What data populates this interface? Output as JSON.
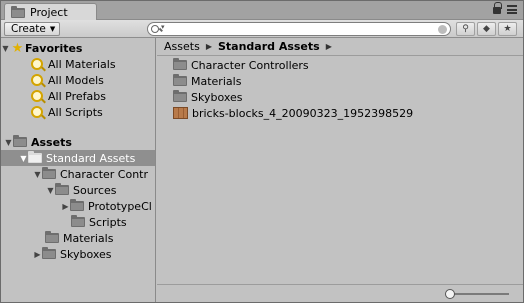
{
  "tab": {
    "title": "Project"
  },
  "toolbar": {
    "create_label": "Create",
    "search_placeholder": ""
  },
  "favorites": {
    "label": "Favorites",
    "items": [
      {
        "label": "All Materials"
      },
      {
        "label": "All Models"
      },
      {
        "label": "All Prefabs"
      },
      {
        "label": "All Scripts"
      }
    ]
  },
  "tree": {
    "assets": "Assets",
    "standard_assets": "Standard Assets",
    "character_controllers": "Character Contr",
    "sources": "Sources",
    "prototype": "PrototypeCl",
    "scripts": "Scripts",
    "materials": "Materials",
    "skyboxes": "Skyboxes"
  },
  "breadcrumb": {
    "root": "Assets",
    "current": "Standard Assets"
  },
  "files": [
    {
      "label": "Character Controllers",
      "icon": "folder-icon"
    },
    {
      "label": "Materials",
      "icon": "folder-icon"
    },
    {
      "label": "Skyboxes",
      "icon": "folder-icon"
    },
    {
      "label": "bricks-blocks_4_20090323_1952398529",
      "icon": "texture-thumbnail-icon"
    }
  ],
  "zoom_slider": {
    "value": 0.0
  }
}
